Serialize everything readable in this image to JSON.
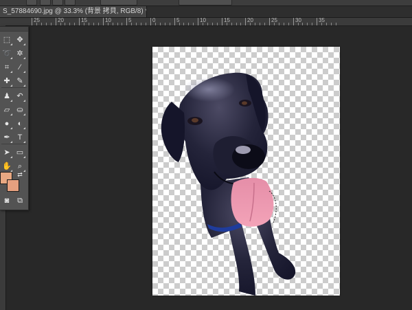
{
  "document": {
    "tab_title": "S_57884690.jpg @ 33.3% (背景 拷貝, RGB/8) *"
  },
  "ruler": {
    "labels": [
      "25",
      "20",
      "15",
      "10",
      "5",
      "0",
      "5",
      "10",
      "15",
      "20",
      "25",
      "30",
      "35"
    ]
  },
  "tools": [
    {
      "name": "marquee-tool-icon",
      "glyph": "⬚"
    },
    {
      "name": "move-tool-icon",
      "glyph": "✥"
    },
    {
      "name": "lasso-tool-icon",
      "glyph": "➰"
    },
    {
      "name": "magic-wand-tool-icon",
      "glyph": "✲"
    },
    {
      "name": "crop-tool-icon",
      "glyph": "⌗"
    },
    {
      "name": "eyedropper-tool-icon",
      "glyph": "⁄"
    },
    {
      "name": "healing-brush-tool-icon",
      "glyph": "✚"
    },
    {
      "name": "brush-tool-icon",
      "glyph": "✎"
    },
    {
      "name": "clone-stamp-tool-icon",
      "glyph": "♟"
    },
    {
      "name": "history-brush-tool-icon",
      "glyph": "↶"
    },
    {
      "name": "eraser-tool-icon",
      "glyph": "▱"
    },
    {
      "name": "paint-bucket-tool-icon",
      "glyph": "⛀"
    },
    {
      "name": "blur-tool-icon",
      "glyph": "●"
    },
    {
      "name": "dodge-tool-icon",
      "glyph": "◐"
    },
    {
      "name": "pen-tool-icon",
      "glyph": "✒"
    },
    {
      "name": "type-tool-icon",
      "glyph": "T"
    },
    {
      "name": "path-selection-tool-icon",
      "glyph": "➤"
    },
    {
      "name": "shape-tool-icon",
      "glyph": "▭"
    },
    {
      "name": "hand-tool-icon",
      "glyph": "✋"
    },
    {
      "name": "zoom-tool-icon",
      "glyph": "⌕"
    }
  ],
  "colors": {
    "foreground": "#e8a882",
    "background": "#e6a07f",
    "workspace": "#282828"
  }
}
